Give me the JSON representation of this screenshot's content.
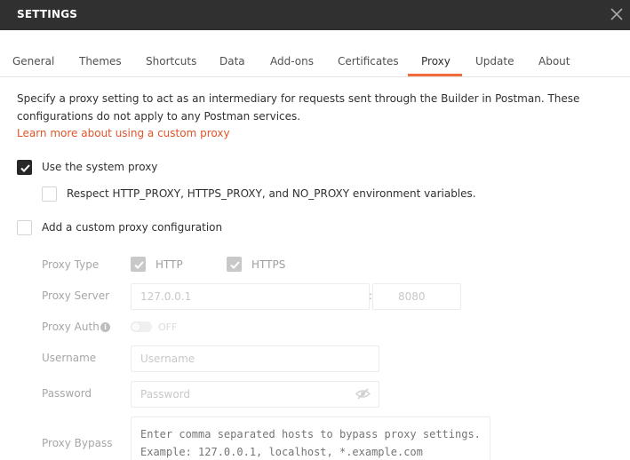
{
  "window": {
    "title": "SETTINGS"
  },
  "tabs": [
    {
      "label": "General"
    },
    {
      "label": "Themes"
    },
    {
      "label": "Shortcuts"
    },
    {
      "label": "Data"
    },
    {
      "label": "Add-ons"
    },
    {
      "label": "Certificates"
    },
    {
      "label": "Proxy"
    },
    {
      "label": "Update"
    },
    {
      "label": "About"
    }
  ],
  "active_tab": "Proxy",
  "proxy": {
    "description": "Specify a proxy setting to act as an intermediary for requests sent through the Builder in Postman. These configurations do not apply to any Postman services.",
    "learn_more": "Learn more about using a custom proxy",
    "use_system_proxy": {
      "label": "Use the system proxy",
      "checked": true
    },
    "respect_env": {
      "label": "Respect HTTP_PROXY, HTTPS_PROXY, and NO_PROXY environment variables.",
      "checked": false
    },
    "custom_proxy": {
      "label": "Add a custom proxy configuration",
      "checked": false
    },
    "proxy_type": {
      "label": "Proxy Type",
      "http": "HTTP",
      "https": "HTTPS",
      "http_checked": true,
      "https_checked": true
    },
    "proxy_server": {
      "label": "Proxy Server",
      "host_placeholder": "127.0.0.1",
      "separator": ":",
      "port_placeholder": "8080"
    },
    "proxy_auth": {
      "label": "Proxy Auth",
      "info_glyph": "i",
      "state": "OFF"
    },
    "username": {
      "label": "Username",
      "placeholder": "Username"
    },
    "password": {
      "label": "Password",
      "placeholder": "Password"
    },
    "bypass": {
      "label": "Proxy Bypass",
      "placeholder": "Enter comma separated hosts to bypass proxy settings.\nExample: 127.0.0.1, localhost, *.example.com"
    }
  },
  "colors": {
    "titlebar": "#303030",
    "accent": "#f26b3a",
    "link": "#e0552b"
  },
  "icons": {
    "close": "close-icon",
    "check": "check-icon",
    "info": "info-icon",
    "eye": "eye-slash-icon"
  }
}
